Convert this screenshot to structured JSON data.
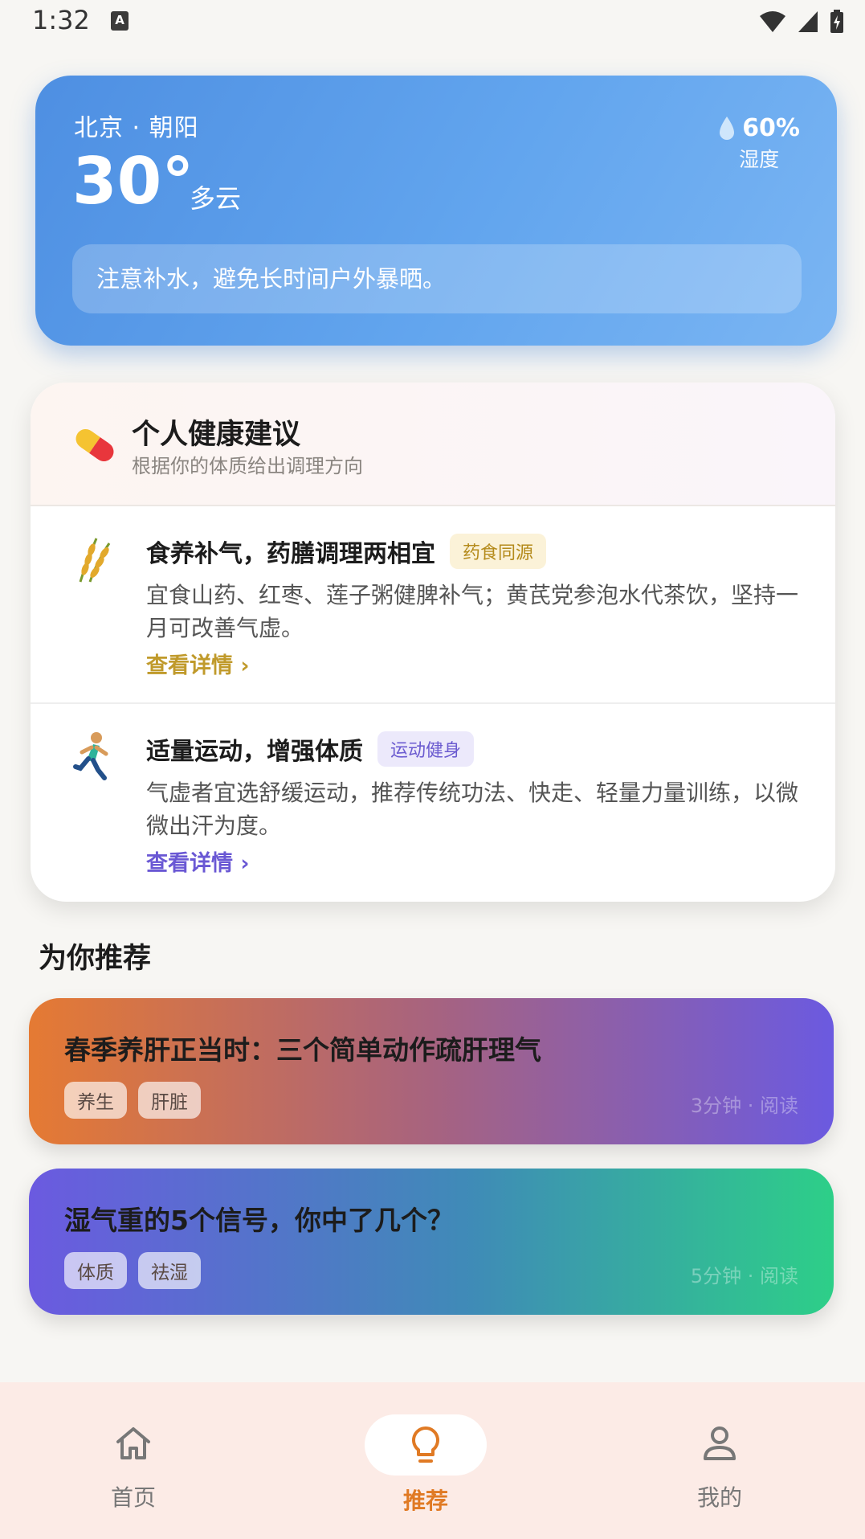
{
  "status_bar": {
    "time": "1:32"
  },
  "weather": {
    "location": "北京 · 朝阳",
    "temperature": "30°",
    "condition": "多云",
    "humidity_value": "60%",
    "humidity_label": "湿度",
    "tip": "注意补水，避免长时间户外暴晒。"
  },
  "health": {
    "title": "个人健康建议",
    "subtitle": "根据你的体质给出调理方向",
    "items": [
      {
        "title": "食养补气，药膳调理两相宜",
        "tag": "药食同源",
        "description": "宜食山药、红枣、莲子粥健脾补气；黄芪党参泡水代茶饮，坚持一月可改善气虚。",
        "link": "查看详情 ›",
        "icon": "rice-icon",
        "accent": "#c09a2b"
      },
      {
        "title": "适量运动，增强体质",
        "tag": "运动健身",
        "description": "气虚者宜选舒缓运动，推荐传统功法、快走、轻量力量训练，以微微出汗为度。",
        "link": "查看详情 ›",
        "icon": "runner-icon",
        "accent": "#6a58d4"
      }
    ]
  },
  "recommend": {
    "heading": "为你推荐",
    "articles": [
      {
        "title": "春季养肝正当时：三个简单动作疏肝理气",
        "tags": [
          "养生",
          "肝脏"
        ],
        "meta": "3分钟 · 阅读"
      },
      {
        "title": "湿气重的5个信号，你中了几个？",
        "tags": [
          "体质",
          "祛湿"
        ],
        "meta": "5分钟 · 阅读"
      }
    ]
  },
  "nav": {
    "home": "首页",
    "recommend": "推荐",
    "me": "我的",
    "active": "recommend",
    "active_color": "#e07a24"
  }
}
